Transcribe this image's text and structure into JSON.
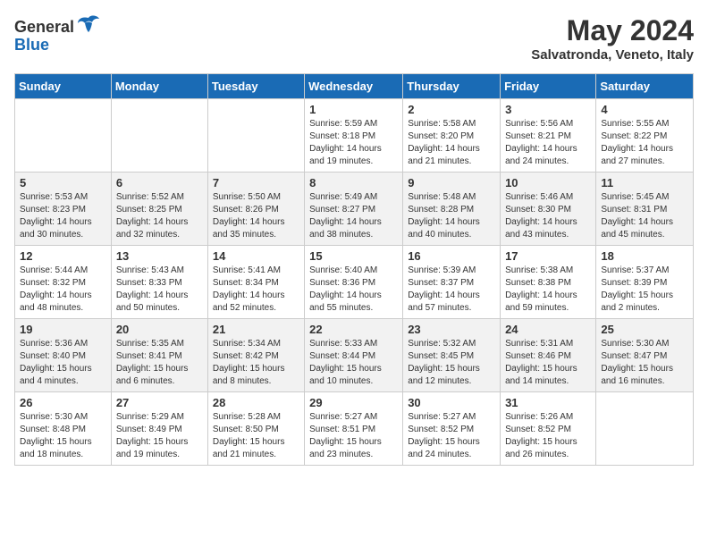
{
  "logo": {
    "general": "General",
    "blue": "Blue"
  },
  "title": "May 2024",
  "location": "Salvatronda, Veneto, Italy",
  "days_of_week": [
    "Sunday",
    "Monday",
    "Tuesday",
    "Wednesday",
    "Thursday",
    "Friday",
    "Saturday"
  ],
  "weeks": [
    [
      {
        "day": "",
        "info": ""
      },
      {
        "day": "",
        "info": ""
      },
      {
        "day": "",
        "info": ""
      },
      {
        "day": "1",
        "info": "Sunrise: 5:59 AM\nSunset: 8:18 PM\nDaylight: 14 hours\nand 19 minutes."
      },
      {
        "day": "2",
        "info": "Sunrise: 5:58 AM\nSunset: 8:20 PM\nDaylight: 14 hours\nand 21 minutes."
      },
      {
        "day": "3",
        "info": "Sunrise: 5:56 AM\nSunset: 8:21 PM\nDaylight: 14 hours\nand 24 minutes."
      },
      {
        "day": "4",
        "info": "Sunrise: 5:55 AM\nSunset: 8:22 PM\nDaylight: 14 hours\nand 27 minutes."
      }
    ],
    [
      {
        "day": "5",
        "info": "Sunrise: 5:53 AM\nSunset: 8:23 PM\nDaylight: 14 hours\nand 30 minutes."
      },
      {
        "day": "6",
        "info": "Sunrise: 5:52 AM\nSunset: 8:25 PM\nDaylight: 14 hours\nand 32 minutes."
      },
      {
        "day": "7",
        "info": "Sunrise: 5:50 AM\nSunset: 8:26 PM\nDaylight: 14 hours\nand 35 minutes."
      },
      {
        "day": "8",
        "info": "Sunrise: 5:49 AM\nSunset: 8:27 PM\nDaylight: 14 hours\nand 38 minutes."
      },
      {
        "day": "9",
        "info": "Sunrise: 5:48 AM\nSunset: 8:28 PM\nDaylight: 14 hours\nand 40 minutes."
      },
      {
        "day": "10",
        "info": "Sunrise: 5:46 AM\nSunset: 8:30 PM\nDaylight: 14 hours\nand 43 minutes."
      },
      {
        "day": "11",
        "info": "Sunrise: 5:45 AM\nSunset: 8:31 PM\nDaylight: 14 hours\nand 45 minutes."
      }
    ],
    [
      {
        "day": "12",
        "info": "Sunrise: 5:44 AM\nSunset: 8:32 PM\nDaylight: 14 hours\nand 48 minutes."
      },
      {
        "day": "13",
        "info": "Sunrise: 5:43 AM\nSunset: 8:33 PM\nDaylight: 14 hours\nand 50 minutes."
      },
      {
        "day": "14",
        "info": "Sunrise: 5:41 AM\nSunset: 8:34 PM\nDaylight: 14 hours\nand 52 minutes."
      },
      {
        "day": "15",
        "info": "Sunrise: 5:40 AM\nSunset: 8:36 PM\nDaylight: 14 hours\nand 55 minutes."
      },
      {
        "day": "16",
        "info": "Sunrise: 5:39 AM\nSunset: 8:37 PM\nDaylight: 14 hours\nand 57 minutes."
      },
      {
        "day": "17",
        "info": "Sunrise: 5:38 AM\nSunset: 8:38 PM\nDaylight: 14 hours\nand 59 minutes."
      },
      {
        "day": "18",
        "info": "Sunrise: 5:37 AM\nSunset: 8:39 PM\nDaylight: 15 hours\nand 2 minutes."
      }
    ],
    [
      {
        "day": "19",
        "info": "Sunrise: 5:36 AM\nSunset: 8:40 PM\nDaylight: 15 hours\nand 4 minutes."
      },
      {
        "day": "20",
        "info": "Sunrise: 5:35 AM\nSunset: 8:41 PM\nDaylight: 15 hours\nand 6 minutes."
      },
      {
        "day": "21",
        "info": "Sunrise: 5:34 AM\nSunset: 8:42 PM\nDaylight: 15 hours\nand 8 minutes."
      },
      {
        "day": "22",
        "info": "Sunrise: 5:33 AM\nSunset: 8:44 PM\nDaylight: 15 hours\nand 10 minutes."
      },
      {
        "day": "23",
        "info": "Sunrise: 5:32 AM\nSunset: 8:45 PM\nDaylight: 15 hours\nand 12 minutes."
      },
      {
        "day": "24",
        "info": "Sunrise: 5:31 AM\nSunset: 8:46 PM\nDaylight: 15 hours\nand 14 minutes."
      },
      {
        "day": "25",
        "info": "Sunrise: 5:30 AM\nSunset: 8:47 PM\nDaylight: 15 hours\nand 16 minutes."
      }
    ],
    [
      {
        "day": "26",
        "info": "Sunrise: 5:30 AM\nSunset: 8:48 PM\nDaylight: 15 hours\nand 18 minutes."
      },
      {
        "day": "27",
        "info": "Sunrise: 5:29 AM\nSunset: 8:49 PM\nDaylight: 15 hours\nand 19 minutes."
      },
      {
        "day": "28",
        "info": "Sunrise: 5:28 AM\nSunset: 8:50 PM\nDaylight: 15 hours\nand 21 minutes."
      },
      {
        "day": "29",
        "info": "Sunrise: 5:27 AM\nSunset: 8:51 PM\nDaylight: 15 hours\nand 23 minutes."
      },
      {
        "day": "30",
        "info": "Sunrise: 5:27 AM\nSunset: 8:52 PM\nDaylight: 15 hours\nand 24 minutes."
      },
      {
        "day": "31",
        "info": "Sunrise: 5:26 AM\nSunset: 8:52 PM\nDaylight: 15 hours\nand 26 minutes."
      },
      {
        "day": "",
        "info": ""
      }
    ]
  ]
}
